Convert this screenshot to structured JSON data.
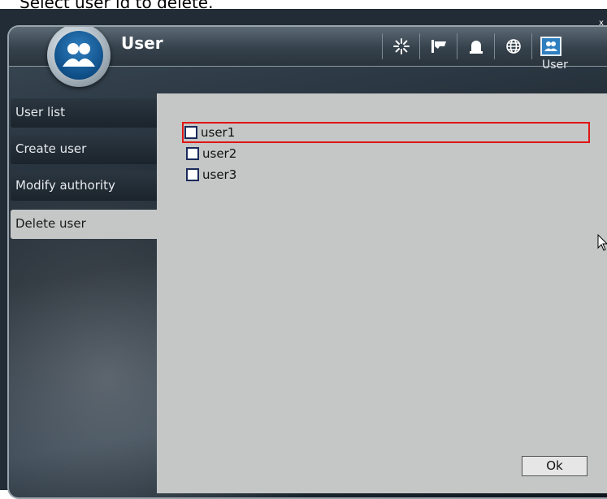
{
  "caption": "Select user id to delete.",
  "header": {
    "title": "User",
    "active_label": "User",
    "close": "x"
  },
  "toolbar": {
    "items": [
      {
        "icon": "loading-icon"
      },
      {
        "icon": "camera-icon"
      },
      {
        "icon": "alarm-icon"
      },
      {
        "icon": "network-globe-icon"
      },
      {
        "icon": "users-icon",
        "active": true
      }
    ]
  },
  "sidebar": {
    "items": [
      {
        "label": "User list"
      },
      {
        "label": "Create user"
      },
      {
        "label": "Modify authority"
      },
      {
        "label": "Delete user",
        "selected": true
      }
    ]
  },
  "users": [
    {
      "name": "user1",
      "checked": false,
      "focused": true
    },
    {
      "name": "user2",
      "checked": false
    },
    {
      "name": "user3",
      "checked": false
    }
  ],
  "buttons": {
    "ok": "Ok"
  },
  "colors": {
    "panel": "#c4c7c6",
    "focus": "#e01515",
    "accent": "#2f7fbf"
  }
}
